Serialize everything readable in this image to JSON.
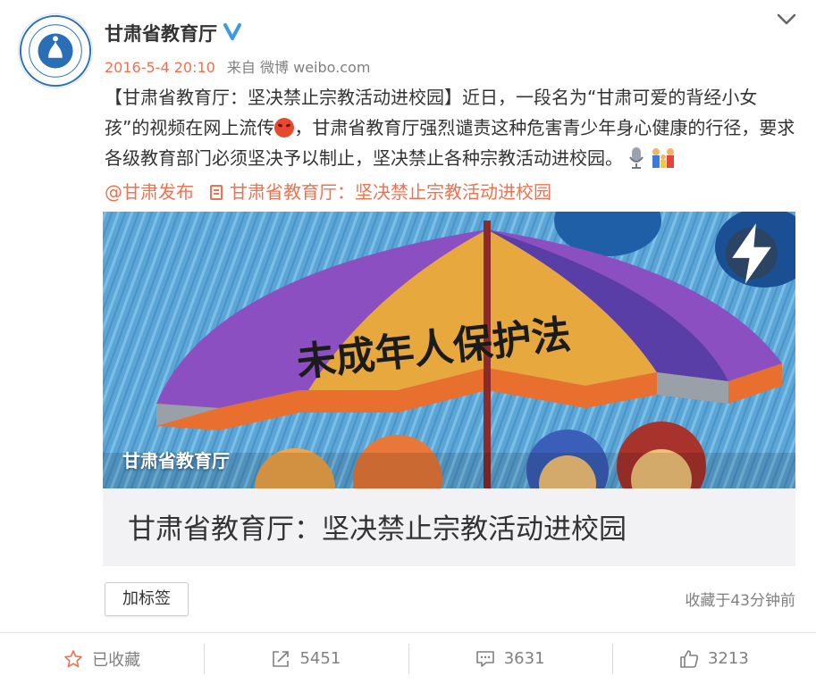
{
  "post": {
    "author": "甘肃省教育厅",
    "date": "2016-5-4 20:10",
    "source_prefix": "来自",
    "source": "微博 weibo.com",
    "text_part1": "【甘肃省教育厅：坚决禁止宗教活动进校园】近日，一段名为“甘肃可爱的背经小女孩”的视频在网上流传",
    "text_part2": "，甘肃省教育厅强烈谴责这种危害青少年身心健康的行径，要求各级教育部门必须坚决予以制止，坚决禁止各种宗教活动进校园。",
    "mention": "@甘肃发布",
    "article_link": "甘肃省教育厅：坚决禁止宗教活动进校园"
  },
  "card": {
    "caption": "甘肃省教育厅",
    "title": "甘肃省教育厅：坚决禁止宗教活动进校园",
    "umbrella_text": "未成年人保护法"
  },
  "footer": {
    "tag_button": "加标签",
    "fav_time": "收藏于43分钟前"
  },
  "actions": {
    "favorite": "已收藏",
    "repost": "5451",
    "comment": "3631",
    "like": "3213"
  },
  "colors": {
    "accent": "#eb7350",
    "verified": "#3a9be3",
    "muted": "#808080"
  },
  "icons": [
    "avatar-logo",
    "verified-icon",
    "chevron-down-icon",
    "angry-emoji-icon",
    "microphone-emoji-icon",
    "family-emoji-icon",
    "document-icon",
    "flash-icon",
    "star-icon",
    "repost-icon",
    "comment-icon",
    "like-icon"
  ]
}
